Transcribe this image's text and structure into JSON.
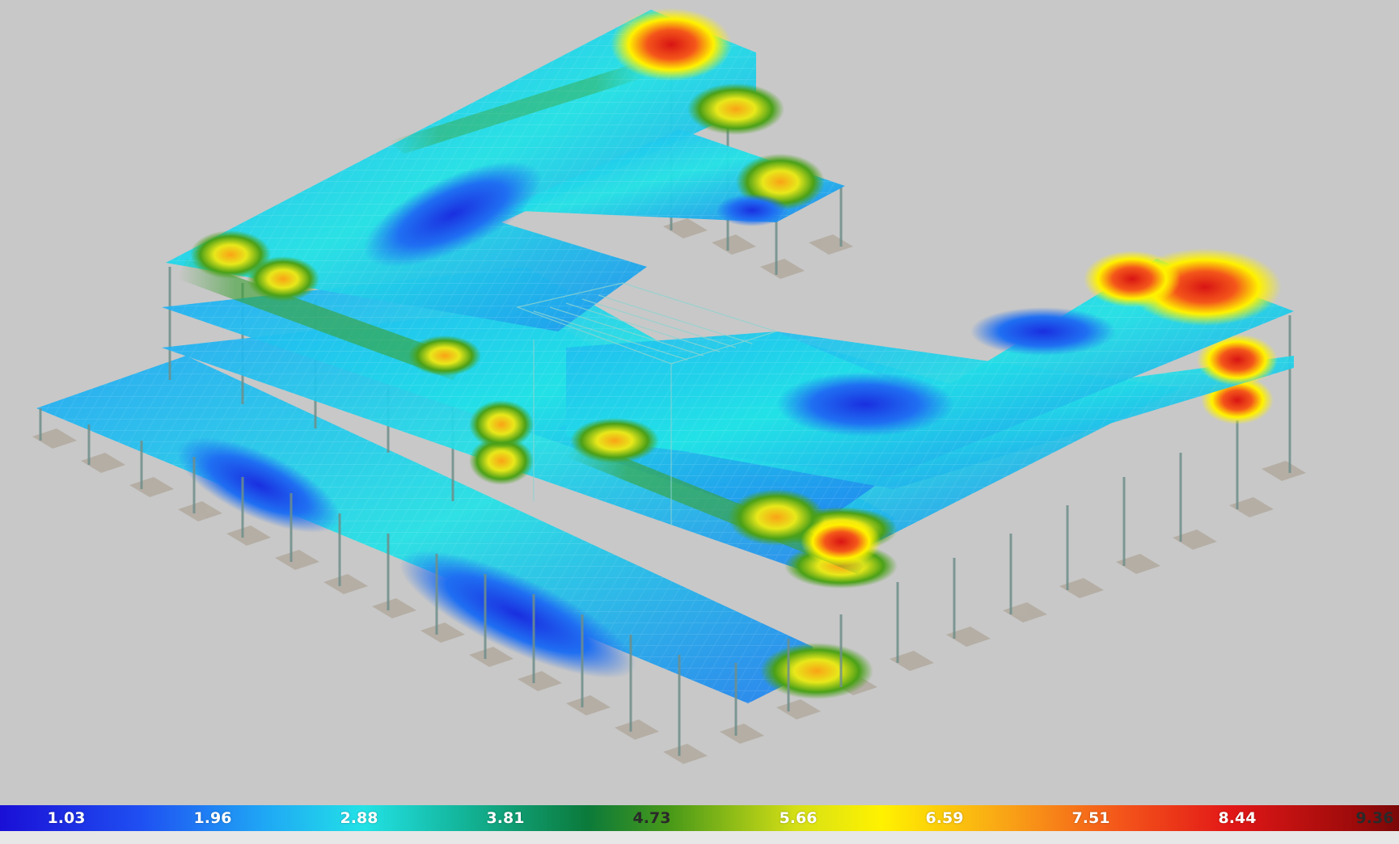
{
  "legend": {
    "ticks": [
      "1.03",
      "1.96",
      "2.88",
      "3.81",
      "4.73",
      "5.66",
      "6.59",
      "7.51",
      "8.44",
      "9.36"
    ]
  },
  "colors": {
    "background": "#c8c8c8",
    "column": "#6f8f8a",
    "footing": "#b3aca2",
    "low": "#1f4ff2",
    "mid": "#22e2e6",
    "green": "#0b7a3a",
    "yellow": "#fff200",
    "high": "#e21717"
  },
  "model": {
    "name": "building-slab-contour-3d-view"
  }
}
